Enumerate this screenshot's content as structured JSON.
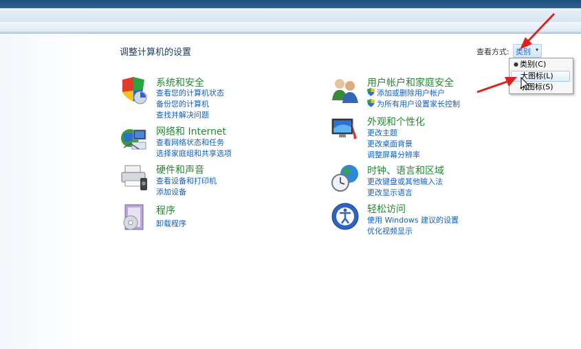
{
  "page": {
    "title": "调整计算机的设置",
    "view_by_label": "查看方式:",
    "view_by_value": "类别",
    "view_menu": [
      {
        "label": "类别(C)",
        "selected": true
      },
      {
        "label": "大图标(L)",
        "selected": false
      },
      {
        "label": "小图标(S)",
        "selected": false
      }
    ]
  },
  "categories": [
    {
      "title": "系统和安全",
      "icon": "system-security-icon",
      "links": [
        "查看您的计算机状态",
        "备份您的计算机",
        "查找并解决问题"
      ]
    },
    {
      "title": "网络和 Internet",
      "icon": "network-internet-icon",
      "links": [
        "查看网络状态和任务",
        "选择家庭组和共享选项"
      ]
    },
    {
      "title": "硬件和声音",
      "icon": "hardware-sound-icon",
      "links": [
        "查看设备和打印机",
        "添加设备"
      ]
    },
    {
      "title": "程序",
      "icon": "programs-icon",
      "links": [
        "卸载程序"
      ]
    },
    {
      "title": "用户帐户和家庭安全",
      "icon": "user-accounts-icon",
      "links": [
        "添加或删除用户帐户",
        "为所有用户设置家长控制"
      ]
    },
    {
      "title": "外观和个性化",
      "icon": "appearance-icon",
      "links": [
        "更改主题",
        "更改桌面背景",
        "调整屏幕分辨率"
      ]
    },
    {
      "title": "时钟、语言和区域",
      "icon": "clock-language-icon",
      "links": [
        "更改键盘或其他输入法",
        "更改显示语言"
      ]
    },
    {
      "title": "轻松访问",
      "icon": "ease-of-access-icon",
      "links": [
        "使用 Windows 建议的设置",
        "优化视频显示"
      ]
    }
  ],
  "colors": {
    "category_title": "#1e8c2e",
    "link": "#0f5fc6",
    "annotation_arrow": "#e0201c"
  }
}
